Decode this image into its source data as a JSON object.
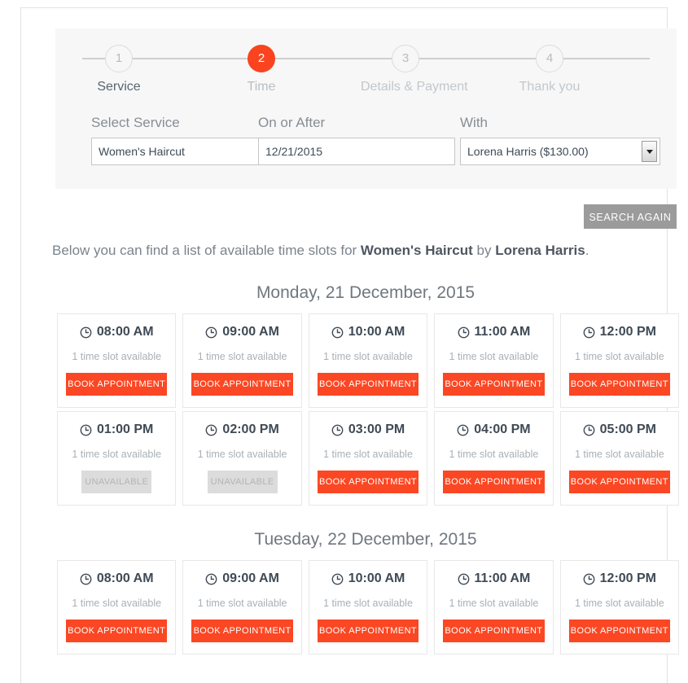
{
  "colors": {
    "accent": "#fb4723",
    "step_active": "#f9441f",
    "muted": "#a9b0b6",
    "button_secondary": "#9b9b9b",
    "disabled": "#dcdcdc"
  },
  "stepper": {
    "steps": [
      {
        "number": "1",
        "label": "Service",
        "state": "done"
      },
      {
        "number": "2",
        "label": "Time",
        "state": "active"
      },
      {
        "number": "3",
        "label": "Details & Payment",
        "state": "upcoming"
      },
      {
        "number": "4",
        "label": "Thank you",
        "state": "upcoming"
      }
    ]
  },
  "filters": {
    "service": {
      "label": "Select Service",
      "value": "Women's Haircut"
    },
    "date": {
      "label": "On or After",
      "value": "12/21/2015",
      "placeholder": "mm/dd/yyyy"
    },
    "provider": {
      "label": "With",
      "value": "Lorena Harris ($130.00)"
    }
  },
  "search_again_label": "SEARCH AGAIN",
  "intro": {
    "prefix": "Below you can find a list of available time slots for ",
    "service": "Women's Haircut",
    "middle": " by ",
    "provider": "Lorena Harris",
    "suffix": "."
  },
  "labels": {
    "availability": "1 time slot available",
    "book": "BOOK APPOINTMENT",
    "unavailable": "UNAVAILABLE",
    "clock_icon": "clock-icon"
  },
  "days": [
    {
      "heading": "Monday, 21 December, 2015",
      "rows": [
        [
          {
            "time": "08:00 AM",
            "availability": "1 time slot available",
            "action": "BOOK APPOINTMENT",
            "enabled": true
          },
          {
            "time": "09:00 AM",
            "availability": "1 time slot available",
            "action": "BOOK APPOINTMENT",
            "enabled": true
          },
          {
            "time": "10:00 AM",
            "availability": "1 time slot available",
            "action": "BOOK APPOINTMENT",
            "enabled": true
          },
          {
            "time": "11:00 AM",
            "availability": "1 time slot available",
            "action": "BOOK APPOINTMENT",
            "enabled": true
          },
          {
            "time": "12:00 PM",
            "availability": "1 time slot available",
            "action": "BOOK APPOINTMENT",
            "enabled": true
          }
        ],
        [
          {
            "time": "01:00 PM",
            "availability": "1 time slot available",
            "action": "UNAVAILABLE",
            "enabled": false
          },
          {
            "time": "02:00 PM",
            "availability": "1 time slot available",
            "action": "UNAVAILABLE",
            "enabled": false
          },
          {
            "time": "03:00 PM",
            "availability": "1 time slot available",
            "action": "BOOK APPOINTMENT",
            "enabled": true
          },
          {
            "time": "04:00 PM",
            "availability": "1 time slot available",
            "action": "BOOK APPOINTMENT",
            "enabled": true
          },
          {
            "time": "05:00 PM",
            "availability": "1 time slot available",
            "action": "BOOK APPOINTMENT",
            "enabled": true
          }
        ]
      ]
    },
    {
      "heading": "Tuesday, 22 December, 2015",
      "rows": [
        [
          {
            "time": "08:00 AM",
            "availability": "1 time slot available",
            "action": "BOOK APPOINTMENT",
            "enabled": true
          },
          {
            "time": "09:00 AM",
            "availability": "1 time slot available",
            "action": "BOOK APPOINTMENT",
            "enabled": true
          },
          {
            "time": "10:00 AM",
            "availability": "1 time slot available",
            "action": "BOOK APPOINTMENT",
            "enabled": true
          },
          {
            "time": "11:00 AM",
            "availability": "1 time slot available",
            "action": "BOOK APPOINTMENT",
            "enabled": true
          },
          {
            "time": "12:00 PM",
            "availability": "1 time slot available",
            "action": "BOOK APPOINTMENT",
            "enabled": true
          }
        ]
      ]
    }
  ]
}
